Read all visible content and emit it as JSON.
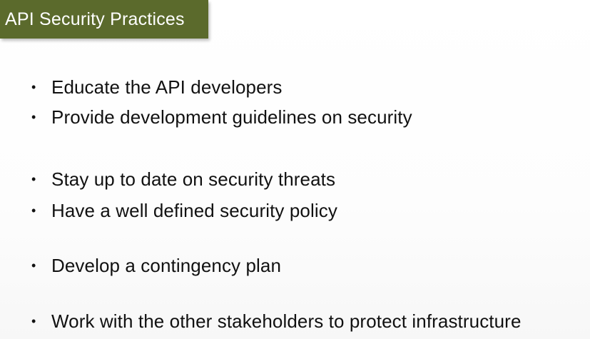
{
  "slide": {
    "title": "API Security Practices",
    "bullets": [
      {
        "text": "Educate the API developers"
      },
      {
        "text": "Provide development guidelines on security"
      },
      {
        "text": "Stay up to date on security threats"
      },
      {
        "text": "Have a well defined security policy"
      },
      {
        "text": "Develop a contingency plan"
      },
      {
        "text": "Work with the other stakeholders to protect infrastructure"
      }
    ]
  },
  "colors": {
    "title_background": "#5b6a2c",
    "title_text": "#ffffff",
    "body_text": "#111111"
  }
}
